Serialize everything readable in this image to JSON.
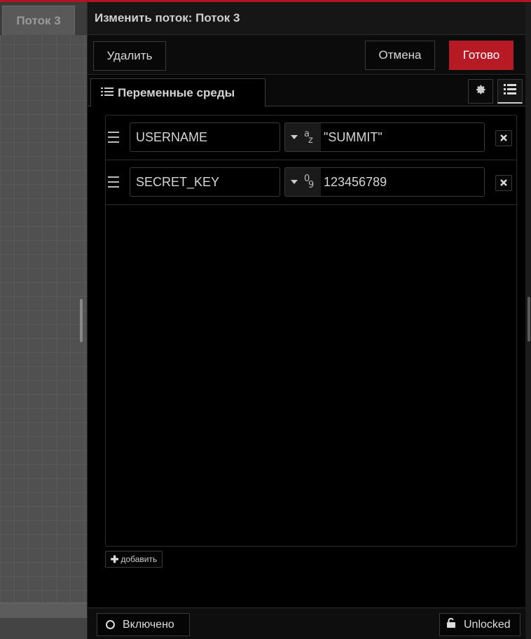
{
  "workspace": {
    "tab_label": "Поток 3"
  },
  "tray": {
    "title": "Изменить поток: Поток 3",
    "toolbar": {
      "delete_label": "Удалить",
      "cancel_label": "Отмена",
      "done_label": "Готово"
    },
    "tabs": {
      "env_label": "Переменные среды",
      "settings_icon": "gear-icon",
      "list_icon": "list-icon"
    },
    "env_vars": [
      {
        "name": "USERNAME",
        "type": "str",
        "type_glyph_top": "a",
        "type_glyph_bottom": "z",
        "value": "\"SUMMIT\""
      },
      {
        "name": "SECRET_KEY",
        "type": "num",
        "type_glyph_top": "0",
        "type_glyph_bottom": "9",
        "value": "123456789"
      }
    ],
    "add_label": "добавить",
    "footer": {
      "enabled_label": "Включено",
      "lock_label": "Unlocked"
    }
  },
  "colors": {
    "accent": "#b51a25",
    "background": "#000000",
    "workspace": "#505050"
  }
}
